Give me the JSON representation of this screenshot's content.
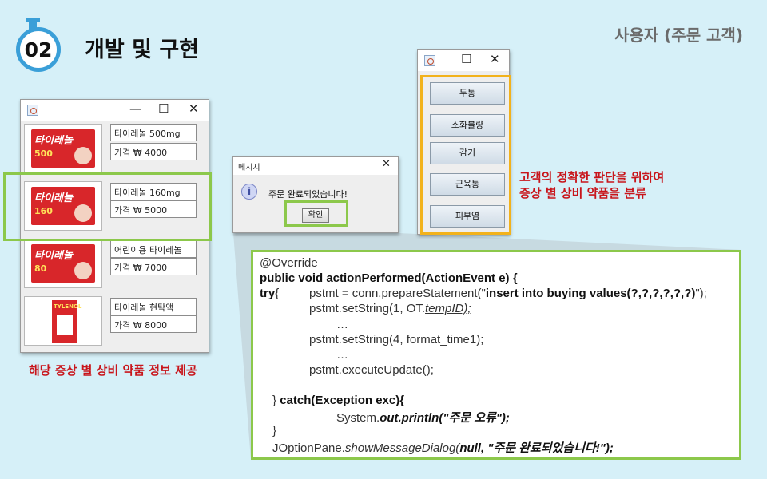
{
  "header": {
    "section_number": "02",
    "section_title": "개발 및 구현",
    "user_label": "사용자 (주문 고객)"
  },
  "window_controls": {
    "minimize": "—",
    "maximize": "☐",
    "close": "✕"
  },
  "product_window": {
    "items": [
      {
        "image_label": "타이레놀",
        "image_dose": "500",
        "name": "타이레놀 500mg",
        "price": "가격 ₩ 4000"
      },
      {
        "image_label": "타이레놀",
        "image_dose": "160",
        "name": "타이레놀 160mg",
        "price": "가격 ₩ 5000"
      },
      {
        "image_label": "타이레놀",
        "image_dose": "80",
        "name": "어린이용 타이레놀",
        "price": "가격 ₩ 7000"
      },
      {
        "image_label": "TYLENOL",
        "image_dose": "",
        "name": "타이레놀 현탁액",
        "price": "가격 ₩ 8000"
      }
    ]
  },
  "message_dialog": {
    "title": "메시지",
    "icon": "i",
    "message": "주문 완료되었습니다!",
    "ok_label": "확인"
  },
  "category_window": {
    "buttons": [
      "두통",
      "소화불량",
      "감기",
      "근육통",
      "피부염"
    ]
  },
  "notes": {
    "category_line1": "고객의 정확한 판단을 위하여",
    "category_line2": "증상 별 상비 약품을 분류",
    "product_caption": "해당 증상 별 상비 약품 정보 제공"
  },
  "code": {
    "l1": "@Override",
    "l2": "public void actionPerformed(ActionEvent e) {",
    "l3_kw": "try",
    "l3_brace": "{",
    "l3_a": "pstmt = conn.prepareStatement(\"",
    "l3_b": "insert into buying values(?,?,?,?,?,?)",
    "l3_c": "\");",
    "l4_a": "pstmt.setString(1, OT.",
    "l4_b": "tempID);",
    "l5": "…",
    "l6": "pstmt.setString(4, format_time1);",
    "l7": "…",
    "l8": "pstmt.executeUpdate();",
    "l9_a": "} ",
    "l9_b": "catch(Exception exc){",
    "l10_a": "System.",
    "l10_b": "out.println",
    "l10_c": "(\"주문 오류\");",
    "l11": "}",
    "l12_a": "JOptionPane.",
    "l12_b": "showMessageDialog(",
    "l12_c": "null",
    "l12_d": ", \"주문 완료되었습니다!\");"
  }
}
